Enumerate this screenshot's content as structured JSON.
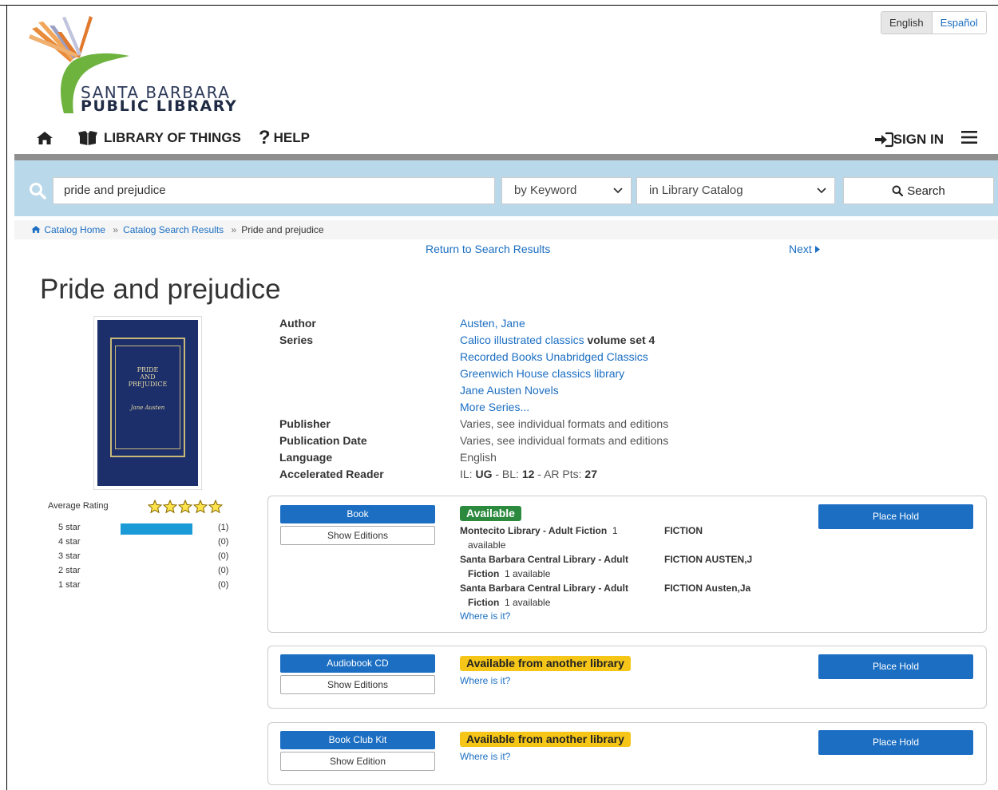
{
  "header": {
    "logo_line1": "SANTA BARBARA",
    "logo_line2": "PUBLIC LIBRARY",
    "languages": [
      "English",
      "Español"
    ]
  },
  "nav": {
    "home_icon": "home-icon",
    "library_of_things": "LIBRARY OF THINGS",
    "help": "HELP",
    "sign_in": "SIGN IN"
  },
  "search": {
    "query": "pride and prejudice",
    "by": "by Keyword",
    "scope": "in Library Catalog",
    "button": "Search"
  },
  "breadcrumb": {
    "home": "Catalog Home",
    "results": "Catalog Search Results",
    "current": "Pride and prejudice",
    "sep": "»"
  },
  "links": {
    "return": "Return to Search Results",
    "next": "Next"
  },
  "title": "Pride and prejudice",
  "cover": {
    "line1": "PRIDE",
    "line2": "AND",
    "line3": "PREJUDICE",
    "line4": "Jane Austen"
  },
  "rating": {
    "label": "Average Rating",
    "average_stars": 5,
    "rows": [
      {
        "label": "5 star",
        "count": "(1)",
        "fraction": 1
      },
      {
        "label": "4 star",
        "count": "(0)",
        "fraction": 0
      },
      {
        "label": "3 star",
        "count": "(0)",
        "fraction": 0
      },
      {
        "label": "2 star",
        "count": "(0)",
        "fraction": 0
      },
      {
        "label": "1 star",
        "count": "(0)",
        "fraction": 0
      }
    ]
  },
  "details": {
    "author_label": "Author",
    "author": "Austen, Jane",
    "series_label": "Series",
    "series1": "Calico illustrated classics",
    "series1_vol": "volume set 4",
    "series2": "Recorded Books Unabridged Classics",
    "series3": "Greenwich House classics library",
    "series4": "Jane Austen Novels",
    "series_more": "More Series...",
    "publisher_label": "Publisher",
    "publisher": "Varies, see individual formats and editions",
    "pubdate_label": "Publication Date",
    "pubdate": "Varies, see individual formats and editions",
    "language_label": "Language",
    "language": "English",
    "ar_label": "Accelerated Reader",
    "ar_il": "IL:",
    "ar_il_val": "UG",
    "ar_bl": "- BL:",
    "ar_bl_val": "12",
    "ar_pts": "- AR Pts:",
    "ar_pts_val": "27"
  },
  "formats": {
    "book": {
      "label": "Book",
      "editions": "Show Editions",
      "status": "Available",
      "hold": "Place Hold",
      "loc1_a": "Montecito Library - Adult Fiction",
      "loc1_b": "1",
      "loc1_c": "available",
      "call1": "FICTION",
      "loc2_a": "Santa Barbara Central Library - Adult",
      "loc2_b": "Fiction",
      "loc2_c": "1 available",
      "call2": "FICTION AUSTEN,J",
      "loc3_a": "Santa Barbara Central Library - Adult",
      "loc3_b": "Fiction",
      "loc3_c": "1 available",
      "call3": "FICTION Austen,Ja",
      "where": "Where is it?"
    },
    "audio": {
      "label": "Audiobook CD",
      "editions": "Show Editions",
      "status": "Available from another library",
      "hold": "Place Hold",
      "where": "Where is it?"
    },
    "kit": {
      "label": "Book Club Kit",
      "editions": "Show Edition",
      "status": "Available from another library",
      "hold": "Place Hold",
      "where": "Where is it?"
    }
  },
  "colors": {
    "accent": "#1b6ec2",
    "search_band": "#b9d8ea",
    "available_green": "#2b8a3e",
    "other_library_yellow": "#f5c518"
  }
}
